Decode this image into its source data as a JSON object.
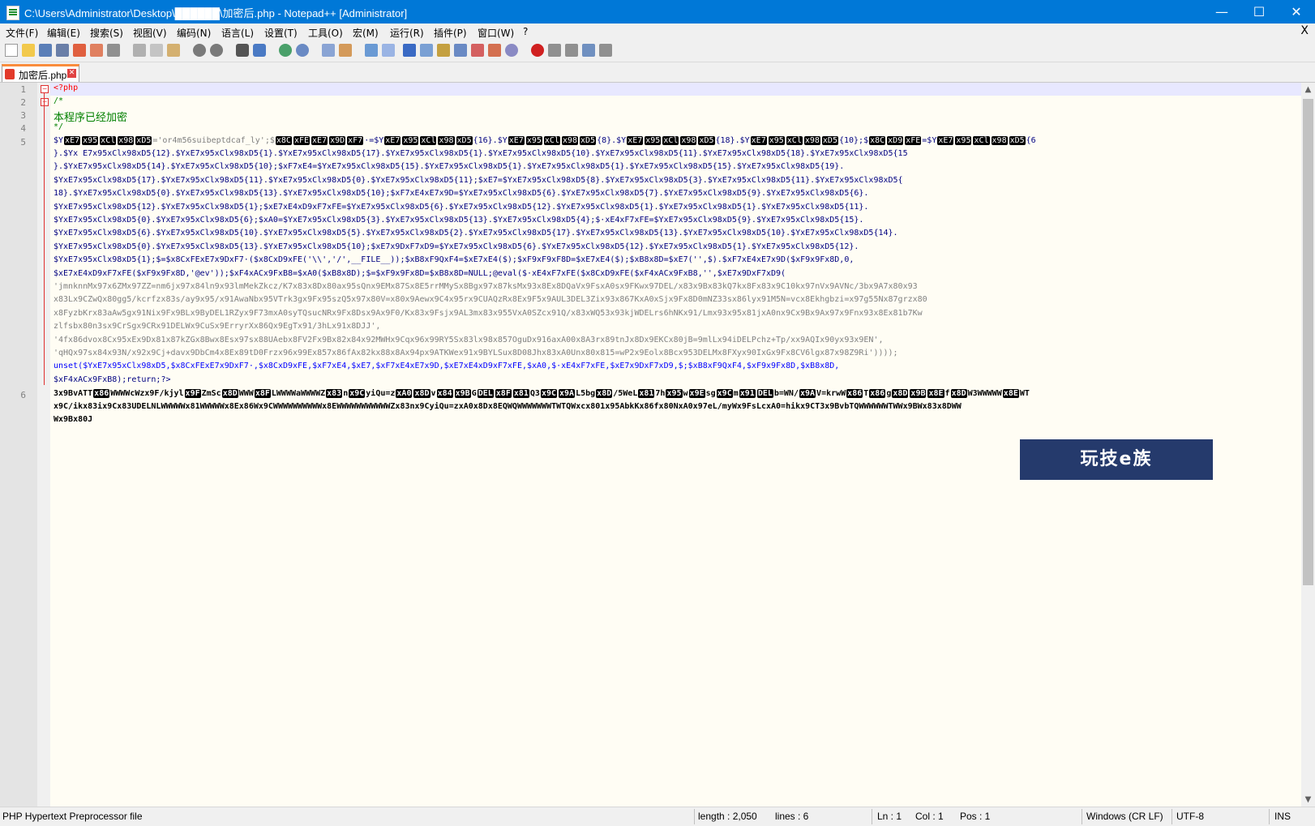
{
  "window": {
    "title": "C:\\Users\\Administrator\\Desktop\\██████\\加密后.php - Notepad++ [Administrator]",
    "minimize": "—",
    "maximize": "☐",
    "close": "✕"
  },
  "menu": {
    "items": [
      "文件(F)",
      "编辑(E)",
      "搜索(S)",
      "视图(V)",
      "编码(N)",
      "语言(L)",
      "设置(T)",
      "工具(O)",
      "宏(M)",
      "运行(R)",
      "插件(P)",
      "窗口(W)",
      "?"
    ],
    "close_doc": "X"
  },
  "toolbar": {
    "icons": [
      "new-file-icon",
      "open-file-icon",
      "save-icon",
      "save-all-icon",
      "close-icon",
      "close-all-icon",
      "print-icon",
      "cut-icon",
      "copy-icon",
      "paste-icon",
      "undo-icon",
      "redo-icon",
      "find-icon",
      "replace-icon",
      "zoom-in-icon",
      "zoom-out-icon",
      "sync-vertical-icon",
      "sync-horizontal-icon",
      "word-wrap-icon",
      "show-all-chars-icon",
      "indent-guide-icon",
      "language-icon",
      "doc-map-icon",
      "function-list-icon",
      "folder-workspace-icon",
      "monitor-icon",
      "record-macro-icon",
      "stop-record-icon",
      "play-macro-icon",
      "run-macro-multiple-icon",
      "save-macro-icon"
    ]
  },
  "tabs": [
    {
      "label": "加密后.php"
    }
  ],
  "editor": {
    "line_numbers": [
      "1",
      "2",
      "3",
      "4",
      "5",
      "6"
    ],
    "lines": [
      {
        "segments": [
          {
            "t": "<?php",
            "c": "php"
          }
        ]
      },
      {
        "segments": [
          {
            "t": "/*",
            "c": "cm"
          }
        ]
      },
      {
        "segments": [
          {
            "t": "本程序已经加密",
            "c": "cm"
          }
        ]
      },
      {
        "segments": [
          {
            "t": "*/",
            "c": "cm"
          }
        ]
      },
      {
        "segments": [
          {
            "t": "$Y",
            "c": "var"
          },
          {
            "t": "xE7",
            "c": "ctrl"
          },
          {
            "t": "x95",
            "c": "ctrl"
          },
          {
            "t": "xCl",
            "c": "ctrl"
          },
          {
            "t": "x98",
            "c": "ctrl"
          },
          {
            "t": "xD5",
            "c": "ctrl"
          },
          {
            "t": "='or4m56suibeptdcaf_ly';$",
            "c": "str"
          },
          {
            "t": "x8C",
            "c": "ctrl"
          },
          {
            "t": "xFE",
            "c": "ctrl"
          },
          {
            "t": "xE7",
            "c": "ctrl"
          },
          {
            "t": "x9D",
            "c": "ctrl"
          },
          {
            "t": "xF7",
            "c": "ctrl"
          },
          {
            "t": "·=$Y",
            "c": "var"
          },
          {
            "t": "xE7",
            "c": "ctrl"
          },
          {
            "t": "x95",
            "c": "ctrl"
          },
          {
            "t": "xCl",
            "c": "ctrl"
          },
          {
            "t": "x98",
            "c": "ctrl"
          },
          {
            "t": "xD5",
            "c": "ctrl"
          },
          {
            "t": "{16}.$Y",
            "c": "var"
          },
          {
            "t": "xE7",
            "c": "ctrl"
          },
          {
            "t": "x95",
            "c": "ctrl"
          },
          {
            "t": "xCl",
            "c": "ctrl"
          },
          {
            "t": "x98",
            "c": "ctrl"
          },
          {
            "t": "xD5",
            "c": "ctrl"
          },
          {
            "t": "{8}.$Y",
            "c": "var"
          },
          {
            "t": "xE7",
            "c": "ctrl"
          },
          {
            "t": "x95",
            "c": "ctrl"
          },
          {
            "t": "xCl",
            "c": "ctrl"
          },
          {
            "t": "x98",
            "c": "ctrl"
          },
          {
            "t": "xD5",
            "c": "ctrl"
          },
          {
            "t": "{18}.$Y",
            "c": "var"
          },
          {
            "t": "xE7",
            "c": "ctrl"
          },
          {
            "t": "x95",
            "c": "ctrl"
          },
          {
            "t": "xCl",
            "c": "ctrl"
          },
          {
            "t": "x98",
            "c": "ctrl"
          },
          {
            "t": "xD5",
            "c": "ctrl"
          },
          {
            "t": "{10};$",
            "c": "var"
          },
          {
            "t": "x8C",
            "c": "ctrl"
          },
          {
            "t": "xD9",
            "c": "ctrl"
          },
          {
            "t": "xFE",
            "c": "ctrl"
          },
          {
            "t": "=$Y",
            "c": "var"
          },
          {
            "t": "xE7",
            "c": "ctrl"
          },
          {
            "t": "x95",
            "c": "ctrl"
          },
          {
            "t": "xCl",
            "c": "ctrl"
          },
          {
            "t": "x98",
            "c": "ctrl"
          },
          {
            "t": "xD5",
            "c": "ctrl"
          },
          {
            "t": "{6",
            "c": "var"
          }
        ]
      },
      {
        "segments": [
          {
            "t": "3x9BvATT",
            "c": "var"
          },
          {
            "t": "x86",
            "c": "ctrl"
          },
          {
            "t": "WWWWcWzx9F/kjyl",
            "c": "var"
          },
          {
            "t": "x9F",
            "c": "ctrl"
          },
          {
            "t": "ZmSc",
            "c": "var"
          },
          {
            "t": "x8D",
            "c": "ctrl"
          },
          {
            "t": "WWW",
            "c": "var"
          },
          {
            "t": "x8F",
            "c": "ctrl"
          },
          {
            "t": "LWWWWaWWWWZ",
            "c": "var"
          },
          {
            "t": "x83",
            "c": "ctrl"
          },
          {
            "t": "n",
            "c": "var"
          },
          {
            "t": "x9C",
            "c": "ctrl"
          },
          {
            "t": "yiQu=z",
            "c": "var"
          },
          {
            "t": "xA0",
            "c": "ctrl"
          },
          {
            "t": "x8D",
            "c": "ctrl"
          },
          {
            "t": "v",
            "c": "var"
          },
          {
            "t": "x84",
            "c": "ctrl"
          },
          {
            "t": "x9B",
            "c": "ctrl"
          },
          {
            "t": "G",
            "c": "var"
          },
          {
            "t": "DEL",
            "c": "ctrl"
          },
          {
            "t": "x8F",
            "c": "ctrl"
          },
          {
            "t": "x81",
            "c": "ctrl"
          },
          {
            "t": "Q3",
            "c": "var"
          },
          {
            "t": "x9C",
            "c": "ctrl"
          },
          {
            "t": "x9A",
            "c": "ctrl"
          },
          {
            "t": "L5bg",
            "c": "var"
          },
          {
            "t": "x8D",
            "c": "ctrl"
          },
          {
            "t": "/5WeL",
            "c": "var"
          },
          {
            "t": "x81",
            "c": "ctrl"
          },
          {
            "t": "7h",
            "c": "var"
          },
          {
            "t": "x95",
            "c": "ctrl"
          },
          {
            "t": "w",
            "c": "var"
          },
          {
            "t": "x9E",
            "c": "ctrl"
          },
          {
            "t": "sg",
            "c": "var"
          },
          {
            "t": "x9C",
            "c": "ctrl"
          },
          {
            "t": "m",
            "c": "var"
          },
          {
            "t": "x91",
            "c": "ctrl"
          },
          {
            "t": "DEL",
            "c": "ctrl"
          },
          {
            "t": "b=WN/",
            "c": "var"
          },
          {
            "t": "x9A",
            "c": "ctrl"
          },
          {
            "t": "V=krwW",
            "c": "var"
          },
          {
            "t": "x86",
            "c": "ctrl"
          },
          {
            "t": "T",
            "c": "var"
          },
          {
            "t": "x86",
            "c": "ctrl"
          },
          {
            "t": "g",
            "c": "var"
          },
          {
            "t": "x8D",
            "c": "ctrl"
          },
          {
            "t": "x9B",
            "c": "ctrl"
          },
          {
            "t": "x8E",
            "c": "ctrl"
          },
          {
            "t": "f",
            "c": "var"
          },
          {
            "t": "x8D",
            "c": "ctrl"
          },
          {
            "t": "W3WWWWW",
            "c": "var"
          },
          {
            "t": "x8E",
            "c": "ctrl"
          },
          {
            "t": "WT",
            "c": "var"
          }
        ]
      }
    ],
    "body_lines": [
      "}.$Yx E7x95xClx98xD5{12}.$YxE7x95xClx98xD5{1}.$YxE7x95xClx98xD5{17}.$YxE7x95xClx98xD5{1}.$YxE7x95xClx98xD5{10}.$YxE7x95xClx98xD5{11}.$YxE7x95xClx98xD5{18}.$YxE7x95xClx98xD5{15",
      "}.$YxE7x95xClx98xD5{14}.$YxE7x95xClx98xD5{10};$xF7xE4=$YxE7x95xClx98xD5{15}.$YxE7x95xClx98xD5{1}.$YxE7x95xClx98xD5{1}.$YxE7x95xClx98xD5{15}.$YxE7x95xClx98xD5{19}.",
      "$YxE7x95xClx98xD5{17}.$YxE7x95xClx98xD5{11}.$YxE7x95xClx98xD5{0}.$YxE7x95xClx98xD5{11};$xE7=$YxE7x95xClx98xD5{8}.$YxE7x95xClx98xD5{3}.$YxE7x95xClx98xD5{11}.$YxE7x95xClx98xD5{",
      "18}.$YxE7x95xClx98xD5{0}.$YxE7x95xClx98xD5{13}.$YxE7x95xClx98xD5{10};$xF7xE4xE7x9D=$YxE7x95xClx98xD5{6}.$YxE7x95xClx98xD5{7}.$YxE7x95xClx98xD5{9}.$YxE7x95xClx98xD5{6}.",
      "$YxE7x95xClx98xD5{12}.$YxE7x95xClx98xD5{1};$xE7xE4xD9xF7xFE=$YxE7x95xClx98xD5{6}.$YxE7x95xClx98xD5{12}.$YxE7x95xClx98xD5{1}.$YxE7x95xClx98xD5{1}.$YxE7x95xClx98xD5{11}.",
      "$YxE7x95xClx98xD5{0}.$YxE7x95xClx98xD5{6};$xA0=$YxE7x95xClx98xD5{3}.$YxE7x95xClx98xD5{13}.$YxE7x95xClx98xD5{4};$·xE4xF7xFE=$YxE7x95xClx98xD5{9}.$YxE7x95xClx98xD5{15}.",
      "$YxE7x95xClx98xD5{6}.$YxE7x95xClx98xD5{10}.$YxE7x95xClx98xD5{5}.$YxE7x95xClx98xD5{2}.$YxE7x95xClx98xD5{17}.$YxE7x95xClx98xD5{13}.$YxE7x95xClx98xD5{10}.$YxE7x95xClx98xD5{14}.",
      "$YxE7x95xClx98xD5{0}.$YxE7x95xClx98xD5{13}.$YxE7x95xClx98xD5{10};$xE7x9DxF7xD9=$YxE7x95xClx98xD5{6}.$YxE7x95xClx98xD5{12}.$YxE7x95xClx98xD5{1}.$YxE7x95xClx98xD5{12}.",
      "$YxE7x95xClx98xD5{1};$=$x8CxFExE7x9DxF7·($x8CxD9xFE('\\\\','/',__FILE__));$xB8xF9QxF4=$xE7xE4($);$xF9xF9xF8D=$xE7xE4($);$xB8x8D=$xE7('',$).$xF7xE4xE7x9D($xF9x9Fx8D,0,",
      "$xE7xE4xD9xF7xFE($xF9x9Fx8D,'@ev'));$xF4xACx9FxB8=$xA0($xB8x8D);$=$xF9x9Fx8D=$xB8x8D=NULL;@eval($·xE4xF7xFE($x8CxD9xFE($xF4xACx9FxB8,'',$xE7x9DxF7xD9(",
      "'jmnknnMx97x6ZMx97ZZ=nm6jx97x84ln9x93lmMekZkcz/K7x83x8Dx80ax95sQnx9EMx87Sx8E5rrMMySx8Bgx97x87ksMx93x8Ex8DQaVx9FsxA0sx9FKwx97DEL/x83x9Bx83kQ7kx8Fx83x9C10kx97nVx9AVNc/3bx9A7x80x93",
      "x83Lx9CZwQx80gg5/kcrfzx83s/ay9x95/x91AwaNbx95VTrk3gx9Fx95szQ5x97x80V=x80x9Aewx9C4x95rx9CUAQzRx8Ex9F5x9AUL3DEL3Zix93x867KxA0xSjx9Fx8D0mNZ33sx86lyx91M5N=vcx8Ekhgbzi=x97g55Nx87grzx80",
      "x8FyzbKrx83aAw5gx91Nix9Fx9BLx9ByDEL1RZyx9F73mxA0syTQsucNRx9Fx8Dsx9Ax9F0/Kx83x9Fsjx9AL3mx83x955VxA0SZcx91Q/x83xWQ53x93kjWDELrs6hNKx91/Lmx93x95x81jxA0nx9Cx9Bx9Ax97x9Fnx93x8Ex81b7Kw",
      "zlfsbx80n3sx9CrSgx9CRx91DELWx9CuSx9ErryrXx86Qx9EgTx91/3hLx91x8DJJ',",
      "'4fx86dvox8Cx95xEx9Dx81x87kZGx8Bwx8Esx97sx88UAebx8FV2Fx9Bx82x84x92MWHx9Cqx96x99RY5Sx83lx98x857OguDx916axA00x8A3rx89tnJx8Dx9EKCx80jB=9mlLx94iDELPchz+Tp/xx9AQIx90yx93x9EN',",
      "'qHQx97sx84x93N/x92x9Cj+davx9DbCm4x8Ex89tD0Frzx96x99Ex857x86fAx82kx88x8Ax94px9ATKWex91x9BYLSux8D08Jhx83xA0Unx80x815=wP2x9Eolx8Bcx953DELMx8FXyx90IxGx9Fx8CV6lgx87x98Z9Ri'))));",
      "unset($YxE7x95xClx98xD5,$x8CxFExE7x9DxF7·,$x8CxD9xFE,$xF7xE4,$xE7,$xF7xE4xE7x9D,$xE7xE4xD9xF7xFE,$xA0,$·xE4xF7xFE,$xE7x9DxF7xD9,$;$xB8xF9QxF4,$xF9x9Fx8D,$xB8x8D,",
      "$xF4xACx9FxB8);return;?>"
    ],
    "line6_cont": [
      "x9C/ikx83ix9Cx83UDELNLWWWWWx81WWWWWx8Ex86Wx9CWWWWWWWWWWx8EWWWWWWWWWWWZx83nx9CyiQu=zxA0x8Dx8EQWQWWWWWWWTWTQWxcx801x95AbkKx86fx80NxA0x97eL/myWx9FsLcxA0=hikx9CT3x9BvbTQWWWWWWTWWx9BWx83x8DWW",
      "Wx9Bx80J"
    ]
  },
  "watermark": "玩技e族",
  "status": {
    "file_type": "PHP Hypertext Preprocessor file",
    "length": "length : 2,050",
    "lines": "lines : 6",
    "ln": "Ln : 1",
    "col": "Col : 1",
    "pos": "Pos : 1",
    "eol": "Windows (CR LF)",
    "encoding": "UTF-8",
    "mode": "INS"
  }
}
